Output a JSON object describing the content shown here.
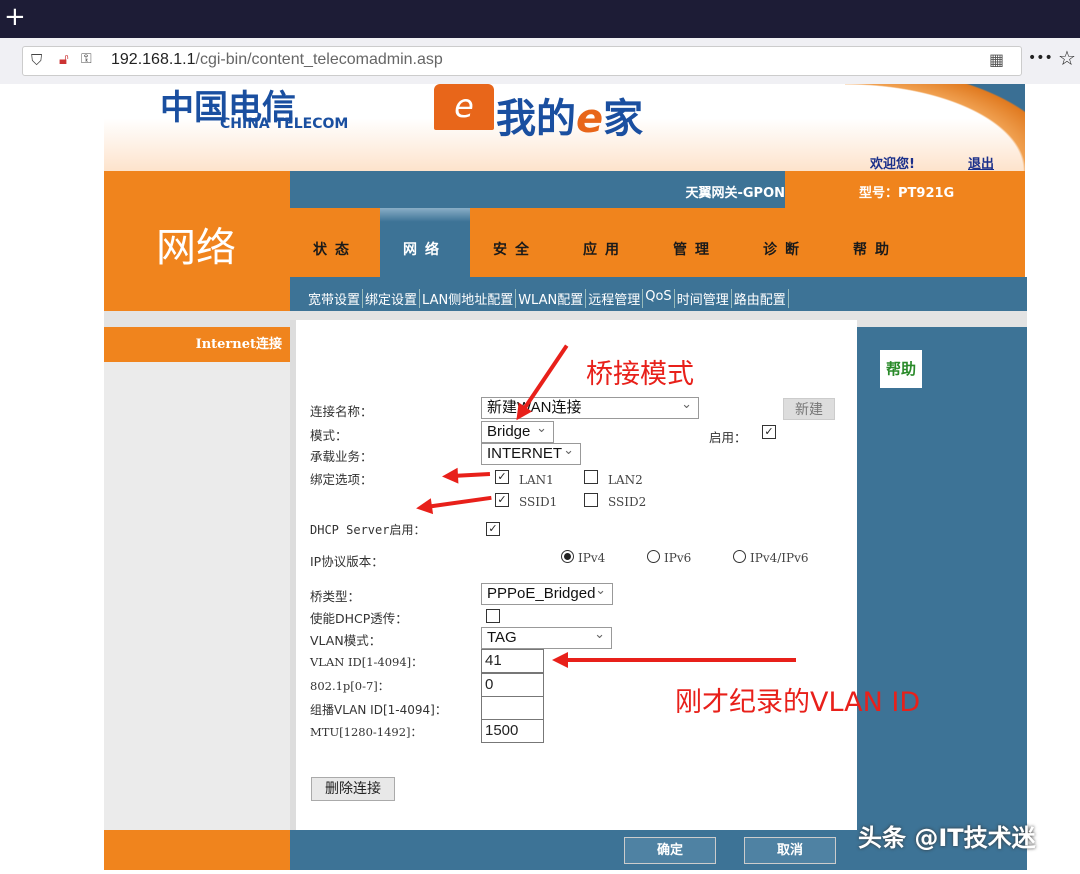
{
  "browser": {
    "new_tab": "+",
    "url_host": "192.168.1.1",
    "url_path": "/cgi-bin/content_telecomadmin.asp",
    "menu": "•••",
    "star": "☆"
  },
  "header": {
    "logo_cn": "中国电信",
    "logo_en": "CHINA TELECOM",
    "brand_e": "e",
    "brand_text": "我的",
    "brand_e2": "e",
    "brand_tail": "家",
    "welcome": "欢迎您!",
    "logout": "退出",
    "gateway": "天翼网关-GPON",
    "model": "型号：PT921G",
    "section": "网络"
  },
  "nav": {
    "items": [
      {
        "label": "状态"
      },
      {
        "label": "网络",
        "selected": true
      },
      {
        "label": "安全"
      },
      {
        "label": "应用"
      },
      {
        "label": "管理"
      },
      {
        "label": "诊断"
      },
      {
        "label": "帮助"
      }
    ],
    "sub": [
      "宽带设置",
      "绑定设置",
      "LAN侧地址配置",
      "WLAN配置",
      "远程管理",
      "QoS",
      "时间管理",
      "路由配置"
    ]
  },
  "sidebar": {
    "item": "Internet连接"
  },
  "help": "帮助",
  "form": {
    "conn_name_label": "连接名称：",
    "conn_name": "新建WAN连接",
    "new_btn": "新建",
    "mode_label": "模式：",
    "mode": "Bridge",
    "enable_label": "启用：",
    "enable": true,
    "service_label": "承载业务：",
    "service": "INTERNET",
    "bind_label": "绑定选项：",
    "lan1": "LAN1",
    "lan2": "LAN2",
    "ssid1": "SSID1",
    "ssid2": "SSID2",
    "bind": {
      "LAN1": true,
      "LAN2": false,
      "SSID1": true,
      "SSID2": false
    },
    "dhcp_label": "DHCP Server启用：",
    "dhcp": true,
    "ip_label": "IP协议版本：",
    "ipv4": "IPv4",
    "ipv6": "IPv6",
    "ipv46": "IPv4/IPv6",
    "ip_selected": "IPv4",
    "bridge_type_label": "桥类型：",
    "bridge_type": "PPPoE_Bridged",
    "dhcp_relay_label": "使能DHCP透传：",
    "dhcp_relay": false,
    "vlan_mode_label": "VLAN模式：",
    "vlan_mode": "TAG",
    "vlan_id_label": "VLAN ID[1-4094]：",
    "vlan_id": "41",
    "p8021_label": "802.1p[0-7]：",
    "p8021": "0",
    "mcast_label": "组播VLAN ID[1-4094]：",
    "mcast": "",
    "mtu_label": "MTU[1280-1492]：",
    "mtu": "1500",
    "delete_btn": "删除连接"
  },
  "footer": {
    "ok": "确定",
    "cancel": "取消"
  },
  "annotations": {
    "bridge_mode": "桥接模式",
    "vlan_note": "刚才纪录的VLAN ID",
    "color": "#e8201a"
  },
  "watermark": "头条 @IT技术迷"
}
